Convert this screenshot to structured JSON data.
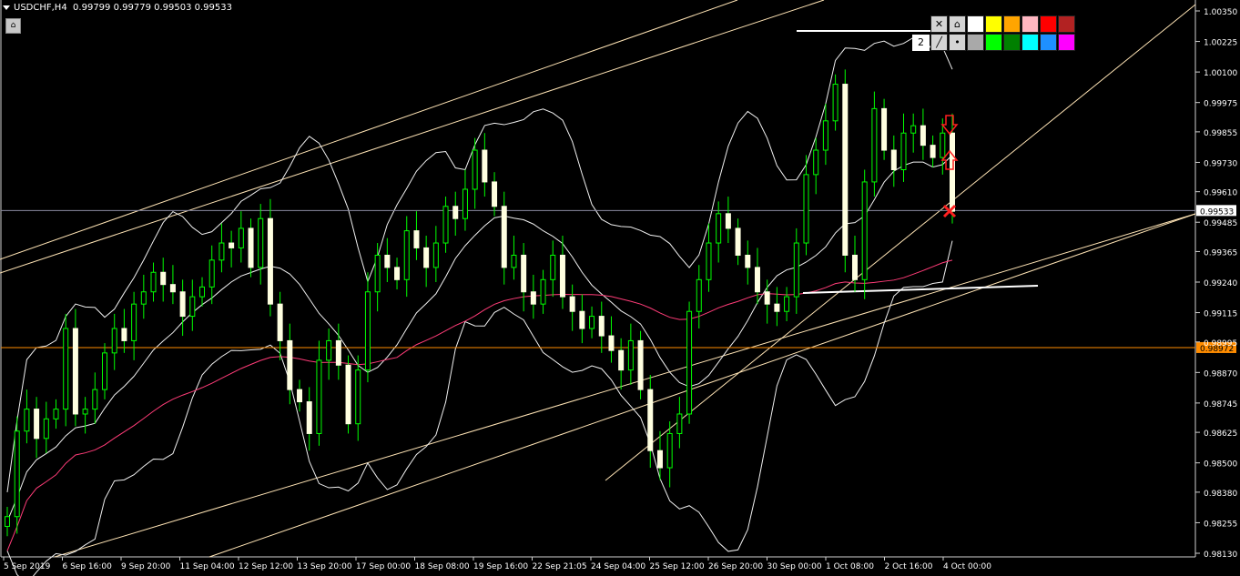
{
  "header": {
    "symbol": "USDCHF,H4",
    "ohlc": "0.99799 0.99779 0.99503 0.99533"
  },
  "palette": {
    "line_count": "2",
    "close_icon": "close-icon",
    "eraser_icon": "eraser-icon",
    "line_icon": "trendline-icon",
    "dot_icon": "dot-icon",
    "row1": [
      "#ffffff",
      "#ffff00",
      "#ffa500",
      "#ffb6c1",
      "#ff0000",
      "#b22222"
    ],
    "row2": [
      "#a9a9a9",
      "#00ff00",
      "#008000",
      "#00ffff",
      "#1e90ff",
      "#ff00ff"
    ]
  },
  "chart_data": {
    "type": "candlestick",
    "title": "USDCHF,H4",
    "ylim": [
      0.9813,
      1.0035
    ],
    "y_ticks": [
      "1.00350",
      "1.00225",
      "1.00100",
      "0.99975",
      "0.99855",
      "0.99730",
      "0.99610",
      "0.99485",
      "0.99365",
      "0.99240",
      "0.99115",
      "0.98995",
      "0.98870",
      "0.98745",
      "0.98625",
      "0.98500",
      "0.98380",
      "0.98255",
      "0.98130"
    ],
    "x_ticks": [
      "5 Sep 2019",
      "6 Sep 16:00",
      "9 Sep 20:00",
      "11 Sep 04:00",
      "12 Sep 12:00",
      "13 Sep 20:00",
      "17 Sep 00:00",
      "18 Sep 08:00",
      "19 Sep 16:00",
      "22 Sep 21:05",
      "24 Sep 04:00",
      "25 Sep 12:00",
      "26 Sep 20:00",
      "30 Sep 00:00",
      "1 Oct 08:00",
      "2 Oct 16:00",
      "4 Oct 00:00"
    ],
    "price_labels": [
      {
        "value": "0.99533",
        "color": "#000000",
        "bg": "#ffffff"
      },
      {
        "value": "0.98972",
        "color": "#000000",
        "bg": "#ff8c00"
      }
    ],
    "candles_close": [
      0.9828,
      0.9863,
      0.9872,
      0.986,
      0.9868,
      0.9872,
      0.9905,
      0.987,
      0.9872,
      0.988,
      0.9895,
      0.9905,
      0.99,
      0.9915,
      0.992,
      0.9928,
      0.9923,
      0.992,
      0.991,
      0.9918,
      0.9922,
      0.9933,
      0.994,
      0.9938,
      0.9946,
      0.993,
      0.995,
      0.9915,
      0.99,
      0.988,
      0.9875,
      0.9862,
      0.9892,
      0.99,
      0.989,
      0.9866,
      0.9888,
      0.992,
      0.9935,
      0.993,
      0.9925,
      0.9945,
      0.9938,
      0.993,
      0.994,
      0.9955,
      0.995,
      0.9962,
      0.9978,
      0.9965,
      0.9955,
      0.993,
      0.9935,
      0.992,
      0.9915,
      0.9925,
      0.9935,
      0.9918,
      0.9912,
      0.9905,
      0.991,
      0.9902,
      0.9896,
      0.9888,
      0.99,
      0.988,
      0.9855,
      0.9848,
      0.9862,
      0.987,
      0.9912,
      0.9925,
      0.994,
      0.9952,
      0.9946,
      0.9935,
      0.993,
      0.992,
      0.9915,
      0.9912,
      0.9918,
      0.994,
      0.9968,
      0.9978,
      0.999,
      1.0005,
      0.9935,
      0.9925,
      0.9965,
      0.9995,
      0.9978,
      0.997,
      0.9985,
      0.9988,
      0.998,
      0.9975,
      0.9985,
      0.9953
    ],
    "bands": "Bollinger-style upper/middle/lower envelope",
    "moving_average_color": "#ff3c78",
    "annotations": [
      "sell-arrow",
      "buy-arrow",
      "stop-cross"
    ]
  }
}
